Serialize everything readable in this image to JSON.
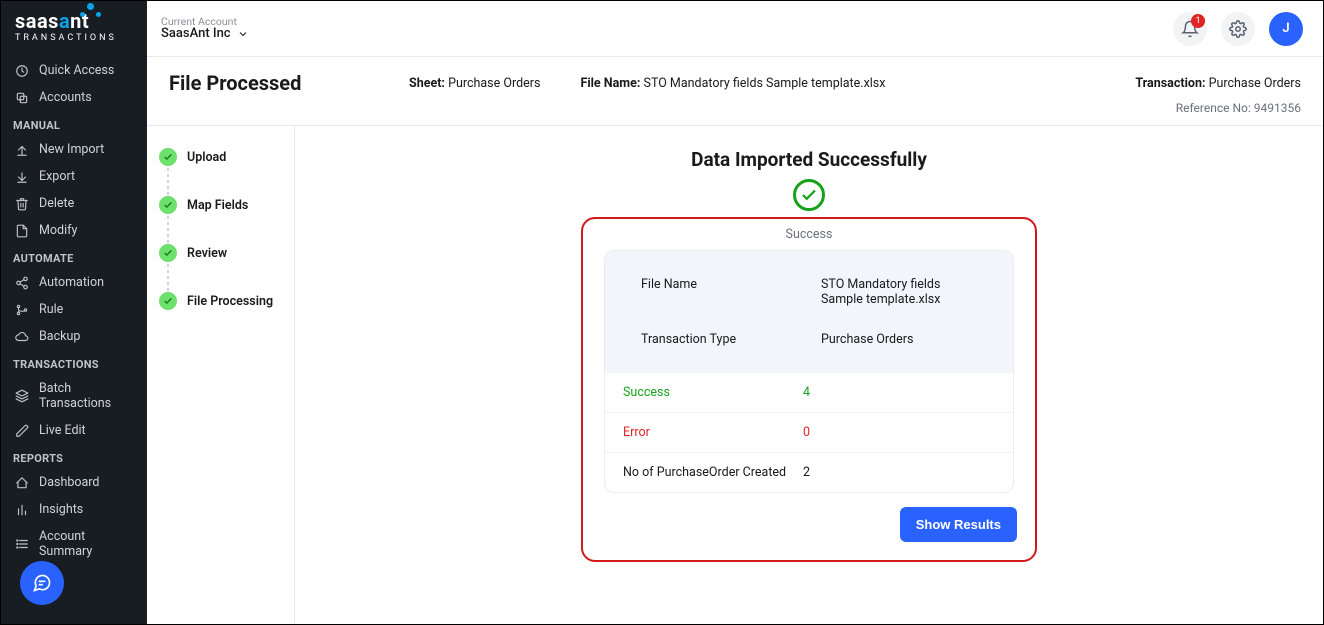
{
  "brand": {
    "name": "saasant",
    "sub": "TRANSACTIONS"
  },
  "topbar": {
    "account_label": "Current Account",
    "account_name": "SaasAnt Inc",
    "notification_count": "1",
    "avatar_initial": "J"
  },
  "sidebar": {
    "top_items": [
      {
        "label": "Quick Access",
        "icon": "clock"
      },
      {
        "label": "Accounts",
        "icon": "copy"
      }
    ],
    "sections": [
      {
        "title": "MANUAL",
        "items": [
          {
            "label": "New Import",
            "icon": "upload"
          },
          {
            "label": "Export",
            "icon": "download"
          },
          {
            "label": "Delete",
            "icon": "trash"
          },
          {
            "label": "Modify",
            "icon": "file"
          }
        ]
      },
      {
        "title": "AUTOMATE",
        "items": [
          {
            "label": "Automation",
            "icon": "share"
          },
          {
            "label": "Rule",
            "icon": "branch"
          },
          {
            "label": "Backup",
            "icon": "cloud"
          }
        ]
      },
      {
        "title": "TRANSACTIONS",
        "items": [
          {
            "label": "Batch Transactions",
            "icon": "layers"
          },
          {
            "label": "Live Edit",
            "icon": "edit"
          }
        ]
      },
      {
        "title": "REPORTS",
        "items": [
          {
            "label": "Dashboard",
            "icon": "home"
          },
          {
            "label": "Insights",
            "icon": "bars"
          },
          {
            "label": "Account Summary",
            "icon": "list"
          }
        ]
      }
    ]
  },
  "page": {
    "title": "File Processed",
    "sheet_label": "Sheet:",
    "sheet_value": "Purchase Orders",
    "filename_label": "File Name:",
    "filename_value": "STO Mandatory fields Sample template.xlsx",
    "transaction_label": "Transaction:",
    "transaction_value": "Purchase Orders",
    "reference_label": "Reference No:",
    "reference_value": "9491356"
  },
  "steps": [
    {
      "label": "Upload"
    },
    {
      "label": "Map Fields"
    },
    {
      "label": "Review"
    },
    {
      "label": "File Processing"
    }
  ],
  "result": {
    "title": "Data Imported Successfully",
    "status": "Success",
    "rows": {
      "filename_key": "File Name",
      "filename_val": "STO Mandatory fields Sample template.xlsx",
      "txn_key": "Transaction Type",
      "txn_val": "Purchase Orders",
      "success_key": "Success",
      "success_val": "4",
      "error_key": "Error",
      "error_val": "0",
      "created_key": "No of PurchaseOrder Created",
      "created_val": "2"
    },
    "show_button": "Show Results"
  }
}
